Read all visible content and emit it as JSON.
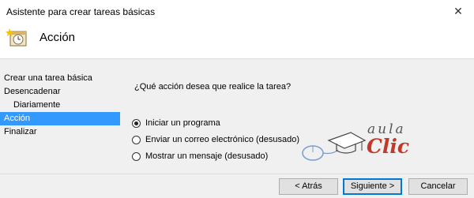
{
  "window": {
    "title": "Asistente para crear tareas básicas",
    "close_glyph": "✕"
  },
  "header": {
    "title": "Acción",
    "icon": "task-clock-icon"
  },
  "sidebar": {
    "items": [
      {
        "label": "Crear una tarea básica"
      },
      {
        "label": "Desencadenar"
      },
      {
        "label": "Diariamente"
      },
      {
        "label": "Acción"
      },
      {
        "label": "Finalizar"
      }
    ],
    "active_index": 3
  },
  "main": {
    "question": "¿Qué acción desea que realice la tarea?",
    "options": [
      {
        "label": "Iniciar un programa",
        "selected": true
      },
      {
        "label": "Enviar un correo electrónico (desusado)",
        "selected": false
      },
      {
        "label": "Mostrar un mensaje (desusado)",
        "selected": false
      }
    ]
  },
  "watermark": {
    "line1": "aula",
    "line2": "Clic"
  },
  "footer": {
    "back_label": "< Atrás",
    "next_label": "Siguiente >",
    "cancel_label": "Cancelar"
  },
  "colors": {
    "selection": "#3399ff",
    "brand_red": "#c0392b"
  }
}
